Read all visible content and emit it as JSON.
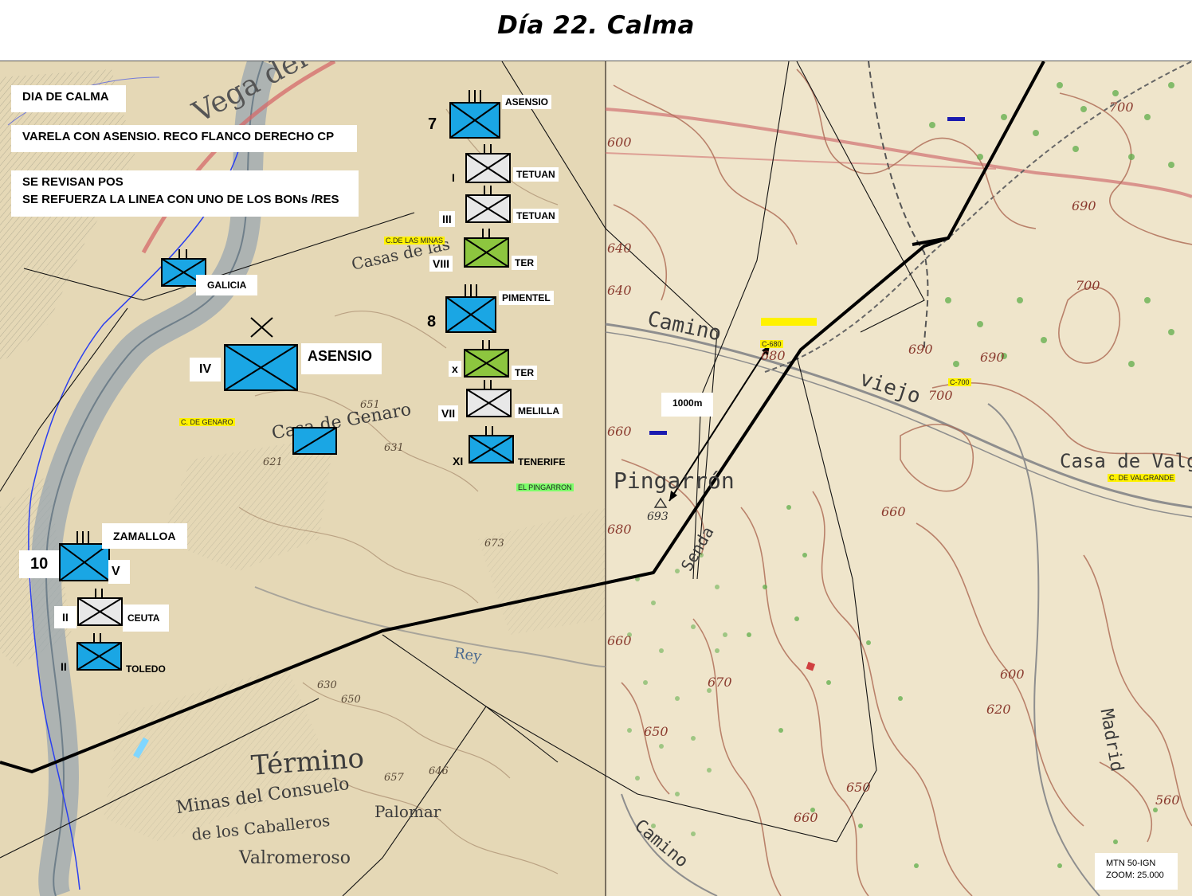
{
  "title": "Día 22. Calma",
  "notes": {
    "line1": "DIA DE CALMA",
    "line2": "VARELA CON ASENSIO. RECO FLANCO DERECHO CP",
    "line3a": "SE REVISAN POS",
    "line3b": "SE REFUERZA LA LINEA CON UNO DE LOS BONs /RES"
  },
  "units": {
    "asensio7": {
      "name": "ASENSIO",
      "number": "7"
    },
    "tetuan1": {
      "roman": "I",
      "name": "TETUAN"
    },
    "tetuan3": {
      "roman": "III",
      "name": "TETUAN"
    },
    "ter8": {
      "roman": "VIII",
      "name": "TER"
    },
    "pimentel8": {
      "name": "PIMENTEL",
      "number": "8"
    },
    "terx": {
      "roman": "x",
      "name": "TER"
    },
    "melilla7": {
      "roman": "VII",
      "name": "MELILLA"
    },
    "tenerife11": {
      "roman": "XI",
      "name": "TENERIFE"
    },
    "galicia": {
      "name": "GALICIA"
    },
    "asensio4": {
      "roman": "IV",
      "name": "ASENSIO"
    },
    "zamalloa10": {
      "name": "ZAMALLOA",
      "number": "10",
      "roman": "V"
    },
    "ceuta2": {
      "roman": "II",
      "name": "CEUTA"
    },
    "toledo2": {
      "roman": "II",
      "name": "TOLEDO"
    }
  },
  "highlights": {
    "minas": "C.DE LAS MINAS",
    "genaro": "C. DE GENARO",
    "pingarron": "EL PINGARRON",
    "c680": "C-680",
    "c700": "C-700",
    "valgrande": "C. DE VALGRANDE"
  },
  "distance": "1000m",
  "source": {
    "line1": "MTN 50-IGN",
    "line2": "ZOOM: 25.000"
  },
  "map_labels": {
    "vega": "Vega del",
    "casas": "Casas de las",
    "casa_genaro": "Casa de Genaro",
    "termino": "Término",
    "minas_consuelo": "Minas del Consuelo",
    "caballeros": "de los Caballeros",
    "valromeroso": "Valromeroso",
    "pingarron": "Pingarrón",
    "camino": "Camino",
    "viejo": "viejo",
    "casa_valgra": "Casa de Valgra",
    "madrid": "Madrid",
    "senda": "Senda",
    "rey": "Rey",
    "palomar": "Palomar"
  },
  "contours": [
    "700",
    "600",
    "690",
    "700",
    "640",
    "640",
    "690",
    "690",
    "700",
    "680",
    "660",
    "680",
    "693",
    "660",
    "660",
    "670",
    "650",
    "600",
    "620",
    "650",
    "660",
    "560",
    "651",
    "631",
    "621",
    "673",
    "630",
    "650",
    "657",
    "646"
  ],
  "colors": {
    "friendly_blue": "#1aa6e4",
    "ter_green": "#8dc63f",
    "reserve_gray": "#d9d9d9",
    "map_paper": "#e6d9b8",
    "map_paper_right": "#ede3c8",
    "road_red": "#d46a6a",
    "river_blue": "#2a3ff0"
  }
}
